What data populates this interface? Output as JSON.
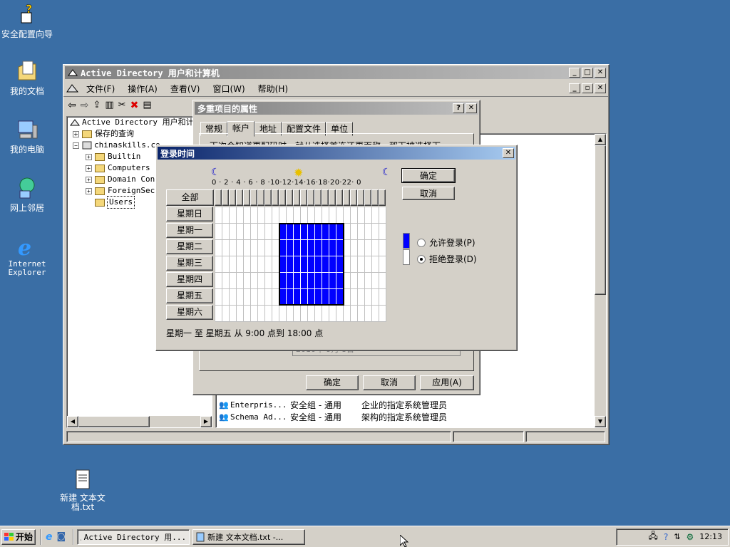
{
  "desktop": {
    "icons": [
      {
        "label": "安全配置向导",
        "icon": "security-wizard-icon"
      },
      {
        "label": "我的文档",
        "icon": "my-documents-icon"
      },
      {
        "label": "我的电脑",
        "icon": "my-computer-icon"
      },
      {
        "label": "网上邻居",
        "icon": "network-places-icon"
      },
      {
        "label": "Internet Explorer",
        "icon": "internet-explorer-icon"
      },
      {
        "label": "新建 文本文档.txt",
        "icon": "text-file-icon"
      }
    ]
  },
  "ad_window": {
    "title": "Active Directory 用户和计算机",
    "menu": [
      "文件(F)",
      "操作(A)",
      "查看(V)",
      "窗口(W)",
      "帮助(H)"
    ],
    "tree": {
      "root": "Active Directory 用户和计",
      "saved_queries": "保存的查询",
      "domain": "chinaskills.co",
      "items": [
        "Builtin",
        "Computers",
        "Domain Con",
        "ForeignSecu",
        "Users"
      ]
    },
    "list_rows": [
      {
        "name": "Enterpris...",
        "type": "安全组 - 通用",
        "desc": "企业的指定系统管理员"
      },
      {
        "name": "Schema Ad...",
        "type": "安全组 - 通用",
        "desc": "架构的指定系统管理员"
      }
    ]
  },
  "props_dialog": {
    "title": "多重项目的属性",
    "help_btn": "?",
    "close_btn": "✕",
    "tabs": [
      "常规",
      "帐户",
      "地址",
      "配置文件",
      "单位"
    ],
    "active_tab": "帐户",
    "partial_text": "下次会知道更配码时，就从选择首连还更面称，那下被选择下",
    "expire_value": "2010年 9月 8日",
    "buttons": {
      "ok": "确定",
      "cancel": "取消",
      "apply": "应用(A)"
    }
  },
  "logon_dialog": {
    "title": "登录时间",
    "close_btn": "✕",
    "hour_labels": "0 · 2 · 4 · 6 · 8 ·10·12·14·16·18·20·22· 0",
    "all_label": "全部",
    "days": [
      "星期日",
      "星期一",
      "星期二",
      "星期三",
      "星期四",
      "星期五",
      "星期六"
    ],
    "ok": "确定",
    "cancel": "取消",
    "allow_label": "允许登录(P)",
    "deny_label": "拒绝登录(D)",
    "selected_option": "deny",
    "summary": "星期一 至 星期五 从 9:00 点到 18:00 点",
    "allowed_days": [
      1,
      2,
      3,
      4,
      5
    ],
    "allowed_hours": [
      9,
      18
    ],
    "colors": {
      "allowed": "#0000ff",
      "denied": "#ffffff"
    }
  },
  "taskbar": {
    "start": "开始",
    "tasks": [
      "Active Directory 用...",
      "新建 文本文档.txt -..."
    ],
    "clock": "12:13"
  }
}
